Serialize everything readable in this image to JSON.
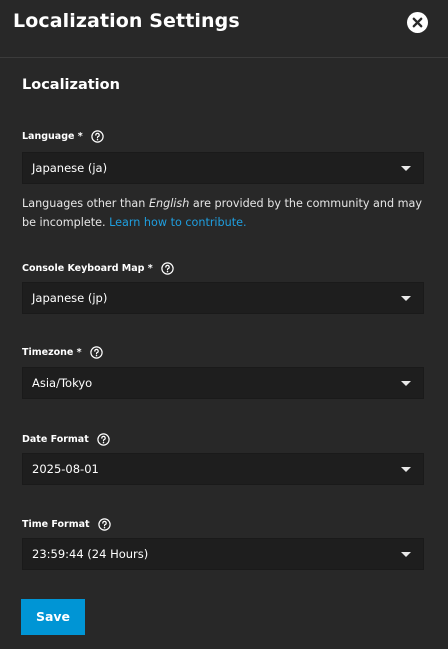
{
  "dialog": {
    "title": "Localization Settings"
  },
  "section": {
    "title": "Localization"
  },
  "fields": {
    "language": {
      "label": "Language *",
      "value": "Japanese (ja)"
    },
    "language_hint": {
      "prefix": "Languages other than ",
      "emphasis": "English",
      "suffix": " are provided by the community and may be incomplete. ",
      "link": "Learn how to contribute."
    },
    "keyboard_map": {
      "label": "Console Keyboard Map *",
      "value": "Japanese (jp)"
    },
    "timezone": {
      "label": "Timezone *",
      "value": "Asia/Tokyo"
    },
    "date_format": {
      "label": "Date Format",
      "value": "2025-08-01"
    },
    "time_format": {
      "label": "Time Format",
      "value": "23:59:44 (24 Hours)"
    }
  },
  "actions": {
    "save_label": "Save"
  },
  "icons": {
    "close": "close-icon",
    "help": "help-circle-icon",
    "dropdown": "chevron-down-icon"
  },
  "colors": {
    "background": "#282828",
    "field_background": "#1e1e1e",
    "accent": "#0095d5",
    "link": "#1f9fe0"
  }
}
